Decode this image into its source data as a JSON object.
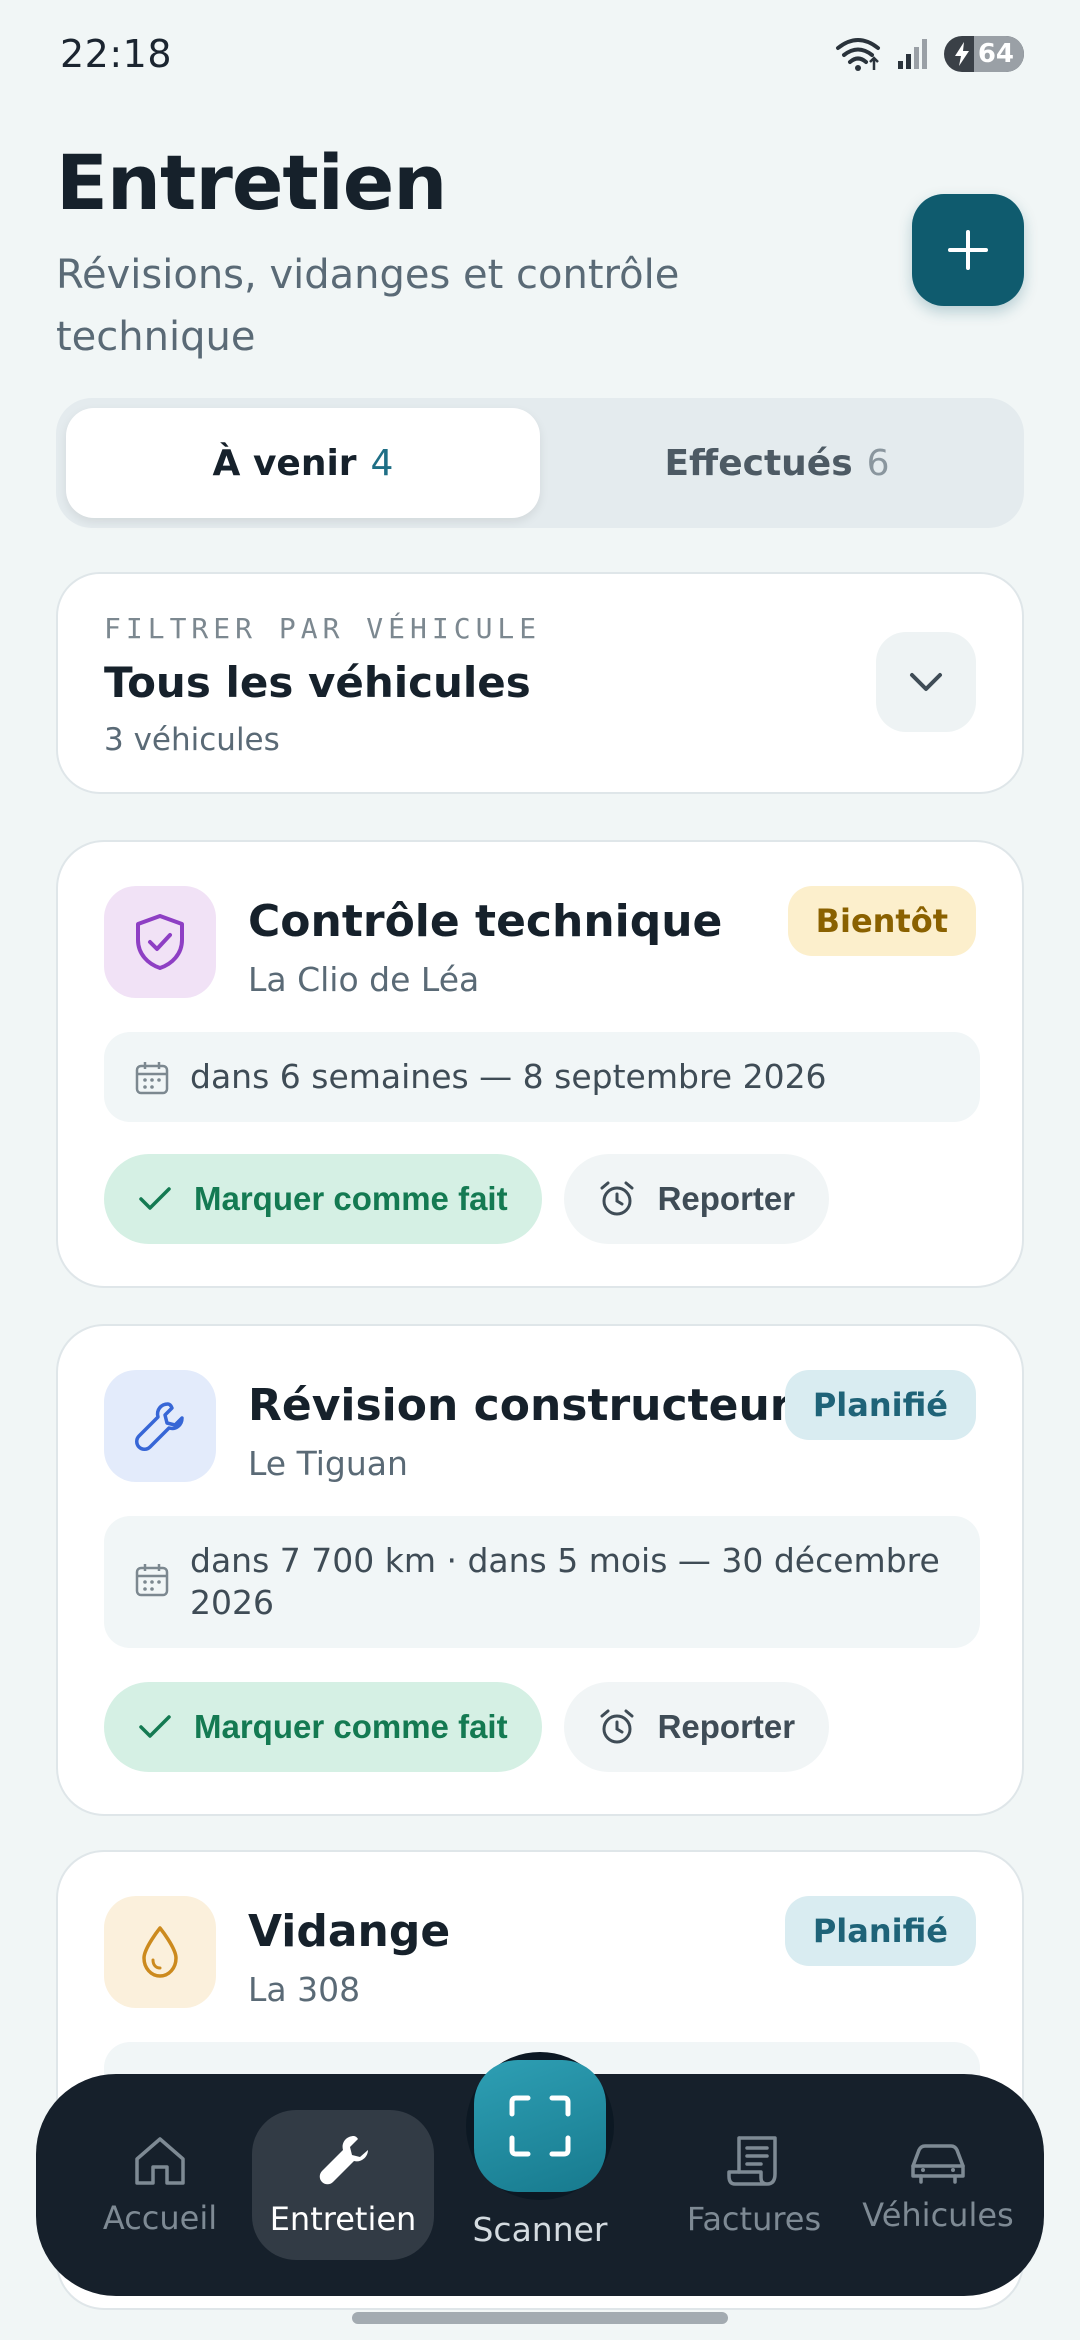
{
  "status_bar": {
    "time": "22:18",
    "battery": "64"
  },
  "header": {
    "title": "Entretien",
    "subtitle": "Révisions, vidanges et contrôle technique"
  },
  "tabs": [
    {
      "label": "À venir",
      "count": "4",
      "active": true
    },
    {
      "label": "Effectués",
      "count": "6",
      "active": false
    }
  ],
  "filter": {
    "label": "FILTRER PAR VÉHICULE",
    "value": "Tous les véhicules",
    "count": "3 véhicules"
  },
  "cards": [
    {
      "title": "Contrôle technique",
      "vehicle": "La Clio de Léa",
      "badge": "Bientôt",
      "due": "dans 6 semaines — 8 septembre 2026",
      "done_label": "Marquer comme fait",
      "later_label": "Reporter",
      "icon": "shield-icon",
      "icon_color": "#8e3fc4",
      "icon_bg": "#f1e2f6"
    },
    {
      "title": "Révision constructeur",
      "vehicle": "Le Tiguan",
      "badge": "Planifié",
      "due": "dans 7 700 km · dans 5 mois — 30 décembre 2026",
      "done_label": "Marquer comme fait",
      "later_label": "Reporter",
      "icon": "wrench-icon",
      "icon_color": "#3766d6",
      "icon_bg": "#e3ebfb"
    },
    {
      "title": "Vidange",
      "vehicle": "La 308",
      "badge": "Planifié",
      "icon": "oil-drop-icon",
      "icon_color": "#cc8a1e",
      "icon_bg": "#fbf0dc"
    }
  ],
  "nav": {
    "home": "Accueil",
    "maintenance": "Entretien",
    "scanner": "Scanner",
    "invoices": "Factures",
    "vehicles": "Véhicules"
  },
  "colors": {
    "accent": "#0f5b6e",
    "success": "#147a52",
    "warning": "#8a6100",
    "nav_bg": "#16202b"
  }
}
